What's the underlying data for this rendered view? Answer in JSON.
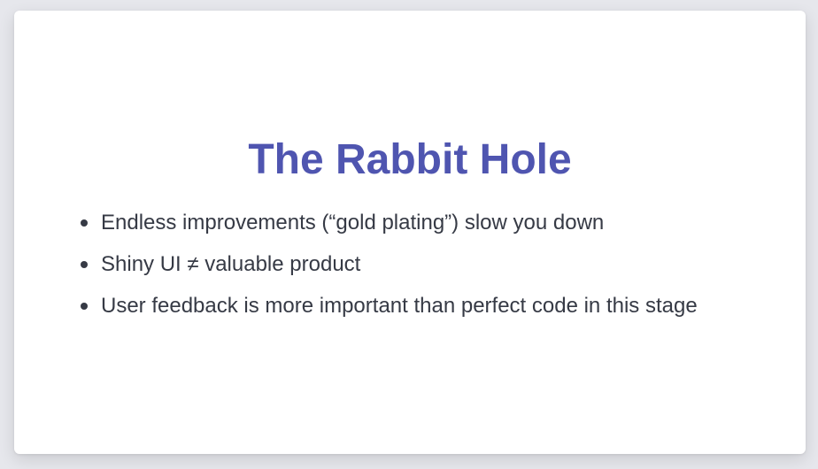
{
  "slide": {
    "title": "The Rabbit Hole",
    "bullets": [
      "Endless improvements (“gold plating”) slow you down",
      "Shiny UI ≠ valuable product",
      "User feedback is more important than perfect code in this stage"
    ]
  },
  "colors": {
    "title": "#4f55b0",
    "text": "#363a45",
    "background": "#e6e7ec",
    "slide": "#ffffff"
  }
}
